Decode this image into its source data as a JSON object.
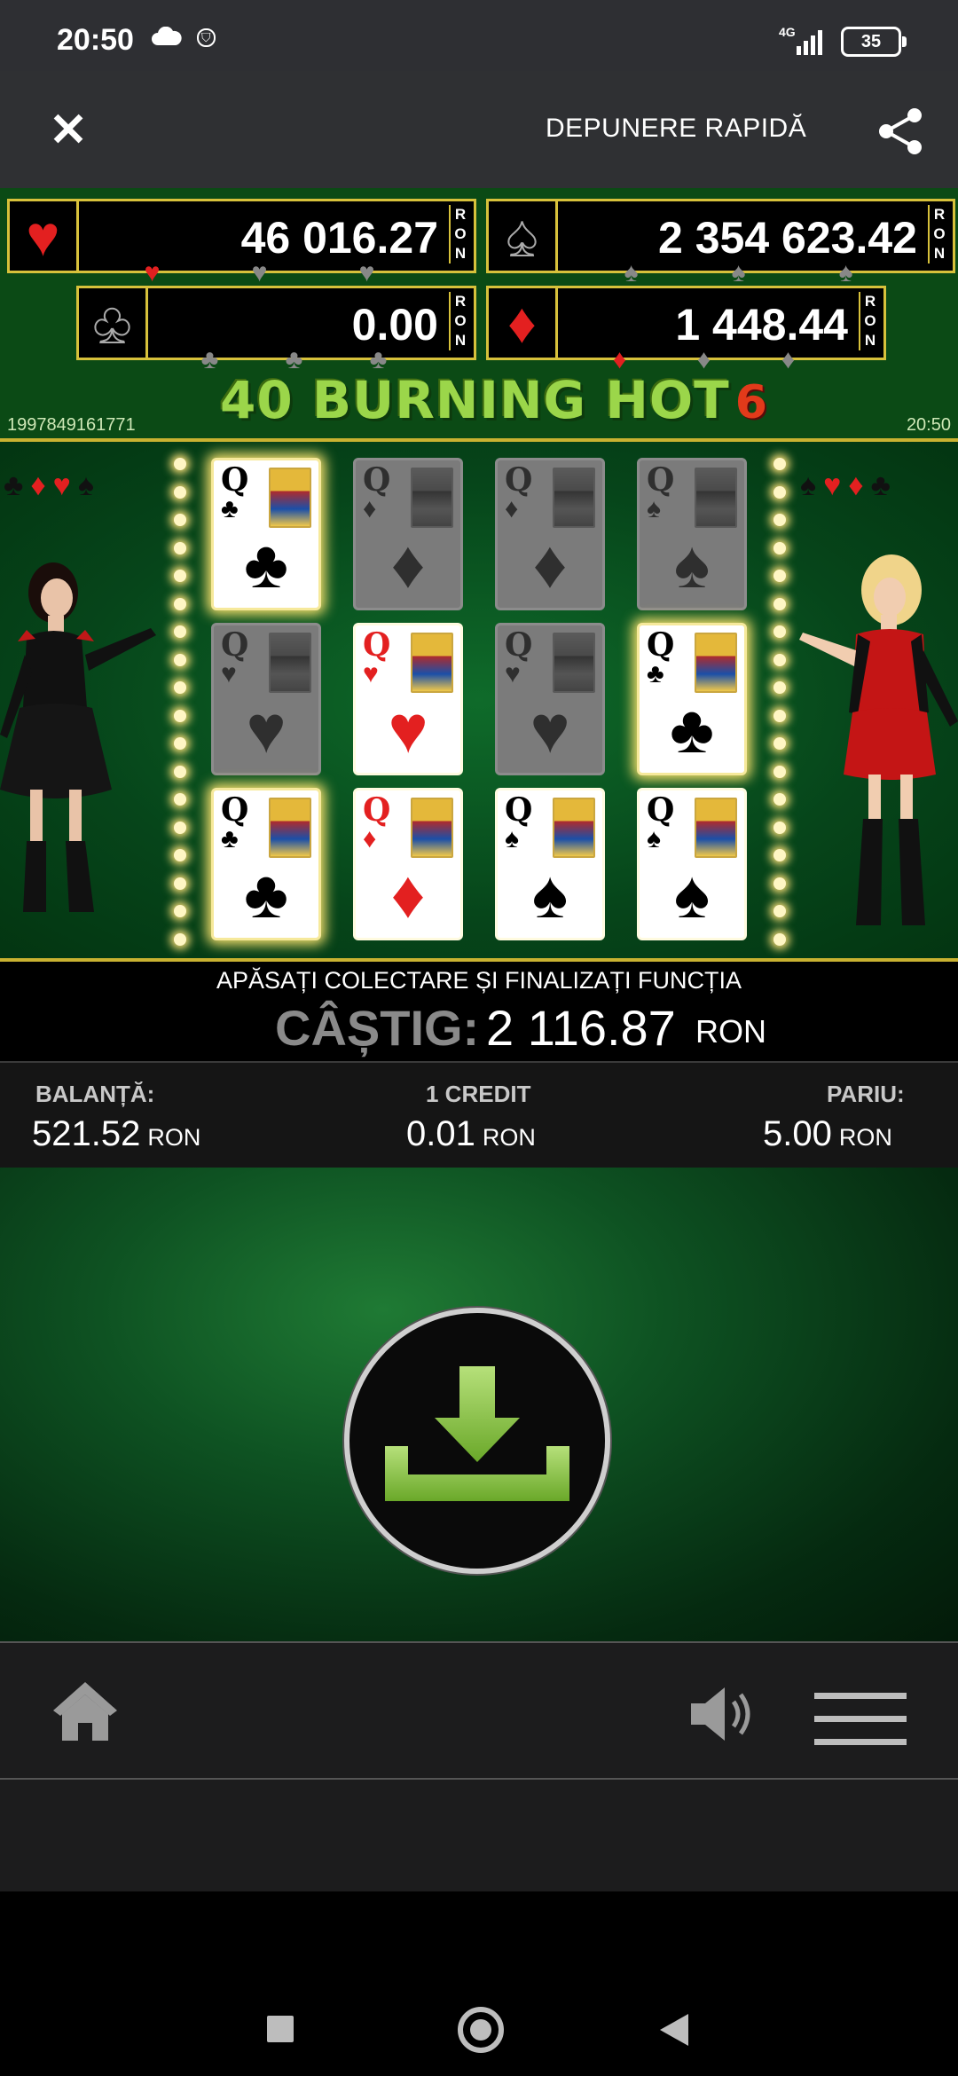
{
  "status_bar": {
    "time": "20:50",
    "network": "4G",
    "battery": "35"
  },
  "top_bar": {
    "deposit_label": "DEPUNERE RAPIDĂ"
  },
  "jackpots": [
    {
      "suit": "♥",
      "value": "46 016.27",
      "currency": "RON",
      "color": "#e32020"
    },
    {
      "suit": "♠",
      "value": "2 354 623.42",
      "currency": "RON",
      "color": "#111111"
    },
    {
      "suit": "♣",
      "value": "0.00",
      "currency": "RON",
      "color": "#111111"
    },
    {
      "suit": "♦",
      "value": "1 448.44",
      "currency": "RON",
      "color": "#e32020"
    }
  ],
  "game": {
    "title": "40 BURNING HOT",
    "title_badge": "6",
    "id": "1997849161771",
    "clock": "20:50"
  },
  "reels": [
    [
      {
        "suit": "♣",
        "lit": true,
        "glow": true
      },
      {
        "suit": "♦",
        "lit": false
      },
      {
        "suit": "♦",
        "lit": false
      },
      {
        "suit": "♠",
        "lit": false
      }
    ],
    [
      {
        "suit": "♥",
        "lit": false
      },
      {
        "suit": "♥",
        "lit": true
      },
      {
        "suit": "♥",
        "lit": false
      },
      {
        "suit": "♣",
        "lit": true,
        "glow": true
      }
    ],
    [
      {
        "suit": "♣",
        "lit": true,
        "glow": true
      },
      {
        "suit": "♦",
        "lit": true
      },
      {
        "suit": "♠",
        "lit": true
      },
      {
        "suit": "♠",
        "lit": true
      }
    ]
  ],
  "card_rank": "Q",
  "win": {
    "message": "APĂSAȚI COLECTARE ȘI FINALIZAȚI FUNCȚIA",
    "label": "CÂȘTIG:",
    "amount": "2 116.87",
    "currency": "RON"
  },
  "info": {
    "balance_label": "BALANȚĂ:",
    "balance_value": "521.52",
    "credit_label": "1 CREDIT",
    "credit_value": "0.01",
    "bet_label": "PARIU:",
    "bet_value": "5.00",
    "currency": "RON"
  },
  "icons": {
    "close": "close-icon",
    "share": "share-icon",
    "collect": "download-icon",
    "home": "home-icon",
    "sound": "speaker-icon",
    "menu": "hamburger-menu-icon"
  },
  "colors": {
    "gold": "#d7c13b",
    "accent_green": "#8cc63f",
    "red": "#e32020"
  }
}
